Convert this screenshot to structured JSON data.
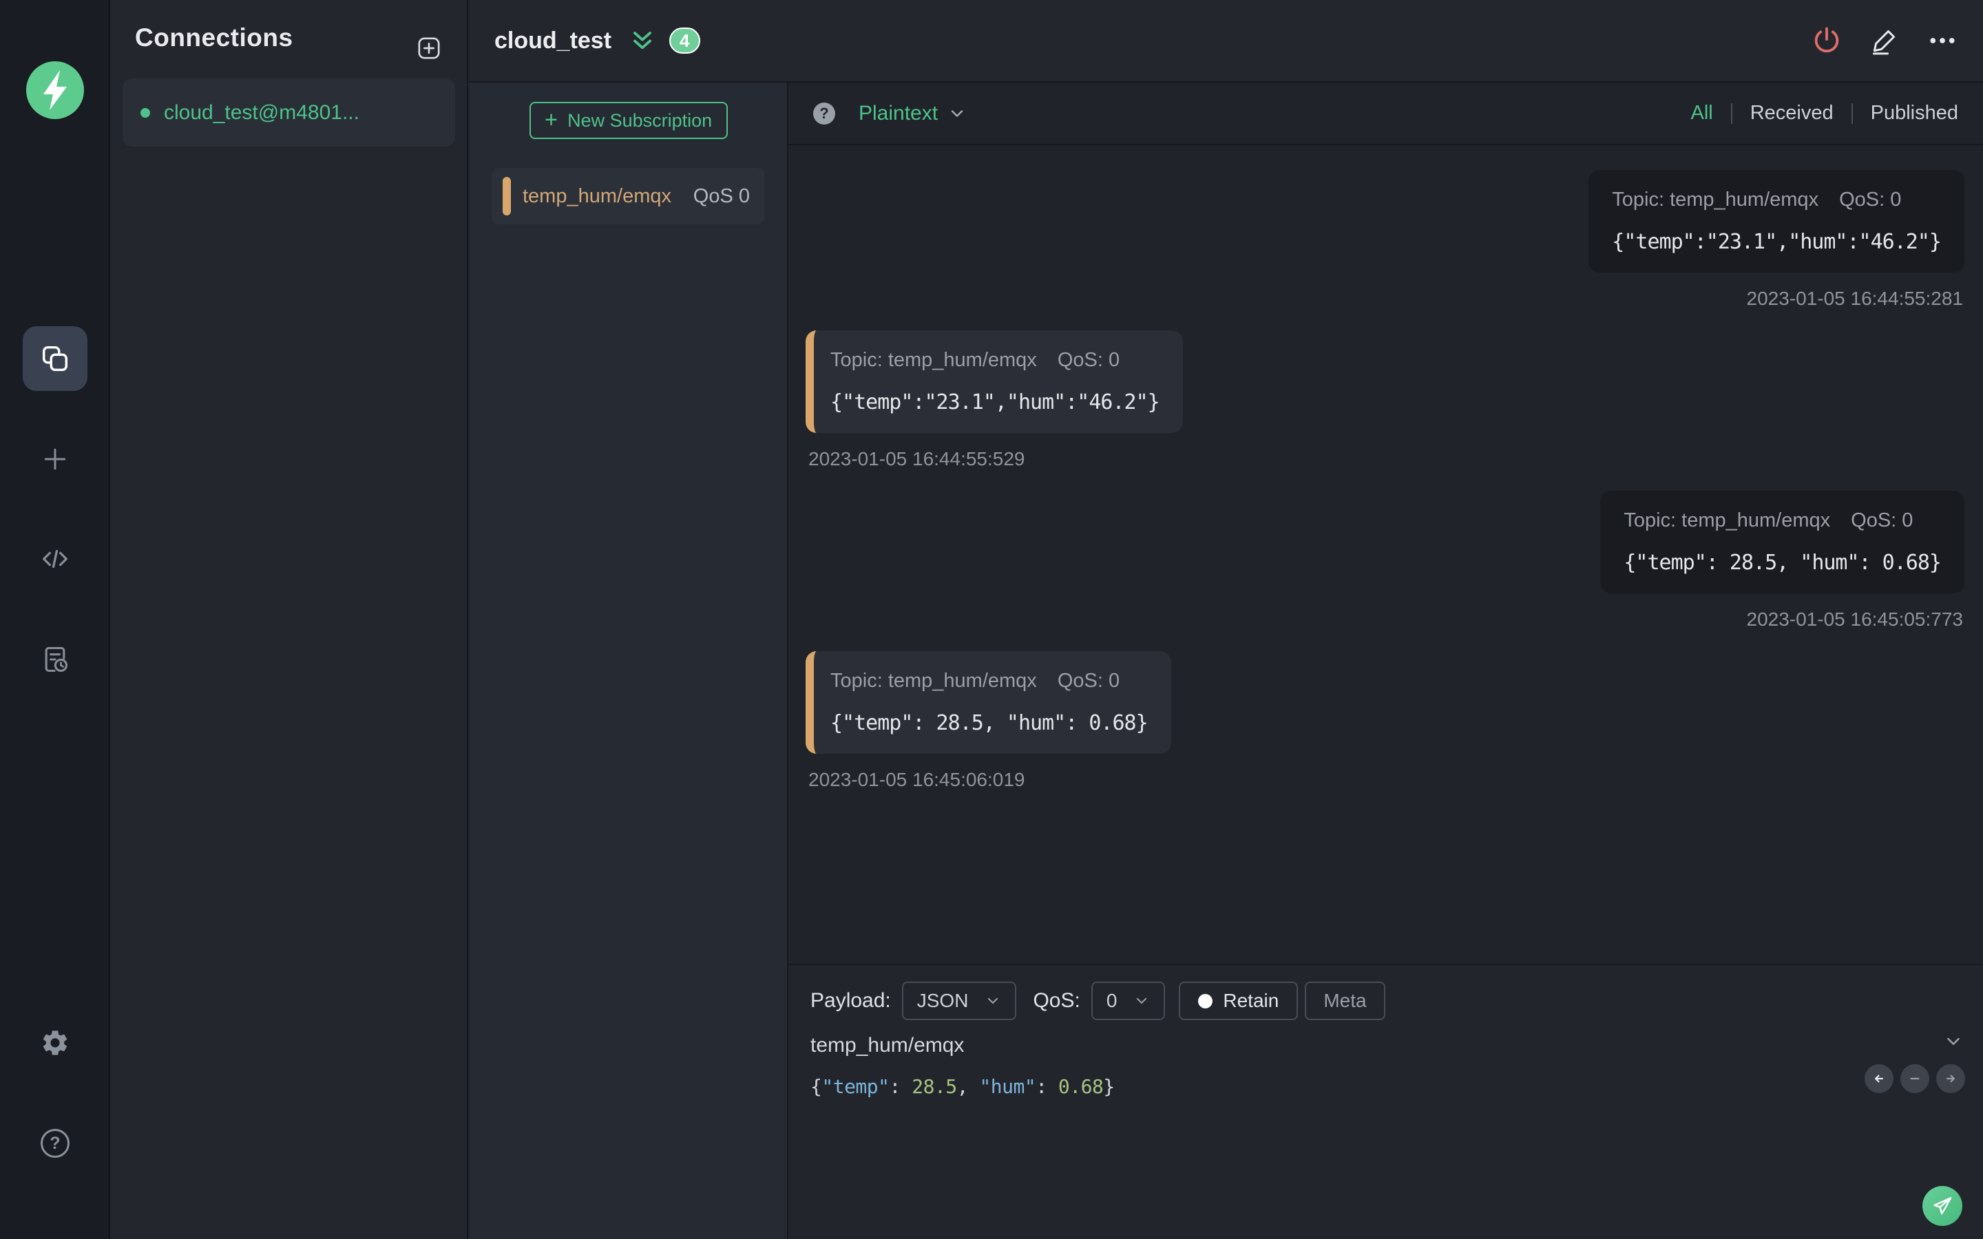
{
  "colors": {
    "accent_green": "#4ec28a",
    "accent_orange": "#d9a76b",
    "power_red": "#e06d6d",
    "panel_bg": "#23262d",
    "received_bubble": "#2b2e36",
    "published_bubble": "#191b20"
  },
  "sidebar": {
    "icons": [
      "mqttx-logo",
      "connections",
      "new-connection",
      "script",
      "log",
      "settings",
      "help"
    ],
    "help_glyph": "?"
  },
  "connections_panel": {
    "title": "Connections",
    "items": [
      {
        "name": "cloud_test@m4801...",
        "connected": true
      }
    ]
  },
  "topbar": {
    "title": "cloud_test",
    "badge_count": "4",
    "icons": [
      "power-icon",
      "edit-icon",
      "more-icon"
    ]
  },
  "subscriptions": {
    "new_button_label": "New Subscription",
    "plus_glyph": "+",
    "items": [
      {
        "topic": "temp_hum/emqx",
        "qos": "QoS 0"
      }
    ]
  },
  "messages": {
    "help_glyph": "?",
    "format": "Plaintext",
    "filters": [
      "All",
      "Received",
      "Published"
    ],
    "active_filter": "All",
    "items": [
      {
        "direction": "published",
        "topic_label": "Topic: temp_hum/emqx",
        "qos_label": "QoS: 0",
        "payload": "{\"temp\":\"23.1\",\"hum\":\"46.2\"}",
        "timestamp": "2023-01-05 16:44:55:281"
      },
      {
        "direction": "received",
        "topic_label": "Topic: temp_hum/emqx",
        "qos_label": "QoS: 0",
        "payload": "{\"temp\":\"23.1\",\"hum\":\"46.2\"}",
        "timestamp": "2023-01-05 16:44:55:529"
      },
      {
        "direction": "published",
        "topic_label": "Topic: temp_hum/emqx",
        "qos_label": "QoS: 0",
        "payload": "{\"temp\": 28.5, \"hum\": 0.68}",
        "timestamp": "2023-01-05 16:45:05:773"
      },
      {
        "direction": "received",
        "topic_label": "Topic: temp_hum/emqx",
        "qos_label": "QoS: 0",
        "payload": "{\"temp\": 28.5, \"hum\": 0.68}",
        "timestamp": "2023-01-05 16:45:06:019"
      }
    ]
  },
  "composer": {
    "payload_label": "Payload:",
    "payload_format": "JSON",
    "qos_label": "QoS:",
    "qos_value": "0",
    "retain_label": "Retain",
    "meta_label": "Meta",
    "topic_value": "temp_hum/emqx",
    "message_tokens": [
      {
        "text": "{",
        "type": "punct"
      },
      {
        "text": "\"temp\"",
        "type": "key"
      },
      {
        "text": ": ",
        "type": "punct"
      },
      {
        "text": "28.5",
        "type": "number"
      },
      {
        "text": ", ",
        "type": "punct"
      },
      {
        "text": "\"hum\"",
        "type": "key"
      },
      {
        "text": ": ",
        "type": "punct"
      },
      {
        "text": "0.68",
        "type": "number"
      },
      {
        "text": "}",
        "type": "punct"
      }
    ]
  }
}
